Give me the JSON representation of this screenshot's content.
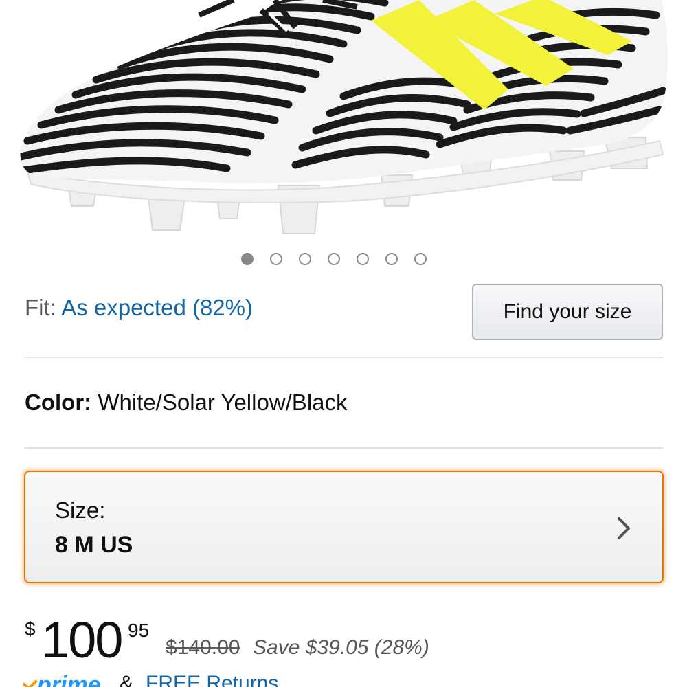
{
  "product": {
    "image_alt": "",
    "carousel": {
      "total": 7,
      "active_index": 0
    }
  },
  "fit": {
    "label": "Fit:",
    "value": "As expected (82%)",
    "find_size_label": "Find your size"
  },
  "color": {
    "label": "Color:",
    "value": "White/Solar Yellow/Black"
  },
  "size": {
    "label": "Size:",
    "value": "8 M US",
    "chevron_icon": "chevron-right-icon"
  },
  "price": {
    "symbol": "$",
    "whole": "100",
    "fraction": "95",
    "list_price": "$140.00",
    "savings": "Save $39.05 (28%)"
  },
  "shipping": {
    "prime_label": "prime",
    "ampersand": "&",
    "free_returns": "FREE Returns"
  },
  "colors": {
    "link": "#1166aa",
    "accent_orange": "#e77600",
    "prime_blue": "#1a98ff"
  }
}
